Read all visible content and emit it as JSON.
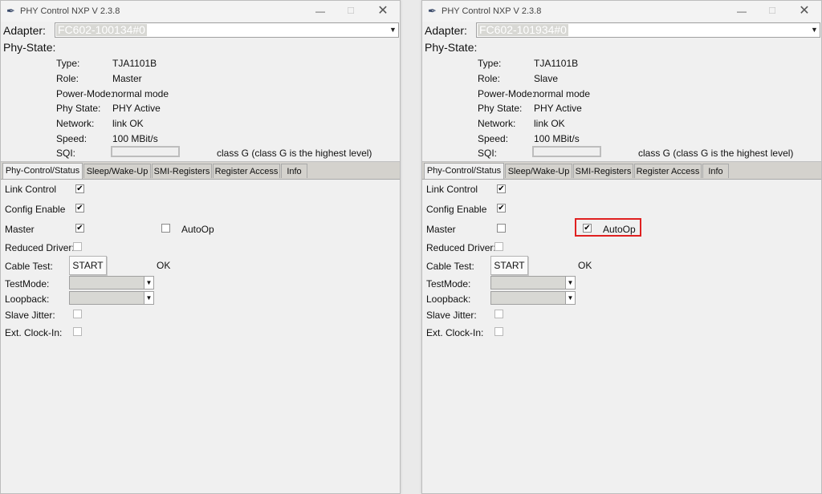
{
  "windows": [
    {
      "title": "PHY Control NXP V 2.3.8",
      "controls": {
        "minimize": "—",
        "maximize": "☐",
        "close": "✕"
      },
      "adapter_label": "Adapter:",
      "adapter_value": "FC602-100134#0",
      "phystate_label": "Phy-State:",
      "info": {
        "type_label": "Type:",
        "type_value": "TJA1101B",
        "role_label": "Role:",
        "role_value": "Master",
        "power_label": "Power-Mode:",
        "power_value": "normal mode",
        "phystate_label": "Phy State:",
        "phystate_value": "PHY Active",
        "network_label": "Network:",
        "network_value": "link OK",
        "speed_label": "Speed:",
        "speed_value": "100 MBit/s",
        "sqi_label": "SQI:",
        "sqi_value": 0,
        "sqi_text": "class G (class G is the highest level)"
      },
      "tabs": [
        "Phy-Control/Status",
        "Sleep/Wake-Up",
        "SMI-Registers",
        "Register Access",
        "Info"
      ],
      "active_tab": 0,
      "controls_panel": {
        "link_control_label": "Link Control",
        "link_control_checked": true,
        "config_enable_label": "Config Enable",
        "config_enable_checked": true,
        "master_label": "Master",
        "master_checked": true,
        "autoop_label": "AutoOp",
        "autoop_checked": false,
        "reduced_driver_label": "Reduced Driver:",
        "reduced_driver_checked": false,
        "cable_test_label": "Cable Test:",
        "start_label": "START",
        "cable_test_result": "OK",
        "testmode_label": "TestMode:",
        "loopback_label": "Loopback:",
        "slave_jitter_label": "Slave Jitter:",
        "slave_jitter_checked": false,
        "ext_clock_label": "Ext. Clock-In:",
        "ext_clock_checked": false
      }
    },
    {
      "title": "PHY Control NXP V 2.3.8",
      "controls": {
        "minimize": "—",
        "maximize": "☐",
        "close": "✕"
      },
      "adapter_label": "Adapter:",
      "adapter_value": "FC602-101934#0",
      "phystate_label": "Phy-State:",
      "info": {
        "type_label": "Type:",
        "type_value": "TJA1101B",
        "role_label": "Role:",
        "role_value": "Slave",
        "power_label": "Power-Mode:",
        "power_value": "normal mode",
        "phystate_label": "Phy State:",
        "phystate_value": "PHY Active",
        "network_label": "Network:",
        "network_value": "link OK",
        "speed_label": "Speed:",
        "speed_value": "100 MBit/s",
        "sqi_label": "SQI:",
        "sqi_value": 0,
        "sqi_text": "class G (class G is the highest level)"
      },
      "tabs": [
        "Phy-Control/Status",
        "Sleep/Wake-Up",
        "SMI-Registers",
        "Register Access",
        "Info"
      ],
      "active_tab": 0,
      "controls_panel": {
        "link_control_label": "Link Control",
        "link_control_checked": true,
        "config_enable_label": "Config Enable",
        "config_enable_checked": true,
        "master_label": "Master",
        "master_checked": false,
        "autoop_label": "AutoOp",
        "autoop_checked": true,
        "reduced_driver_label": "Reduced Driver:",
        "reduced_driver_checked": false,
        "cable_test_label": "Cable Test:",
        "start_label": "START",
        "cable_test_result": "OK",
        "testmode_label": "TestMode:",
        "loopback_label": "Loopback:",
        "slave_jitter_label": "Slave Jitter:",
        "slave_jitter_checked": false,
        "ext_clock_label": "Ext. Clock-In:",
        "ext_clock_checked": false
      }
    }
  ],
  "highlight_color": "#e02020"
}
